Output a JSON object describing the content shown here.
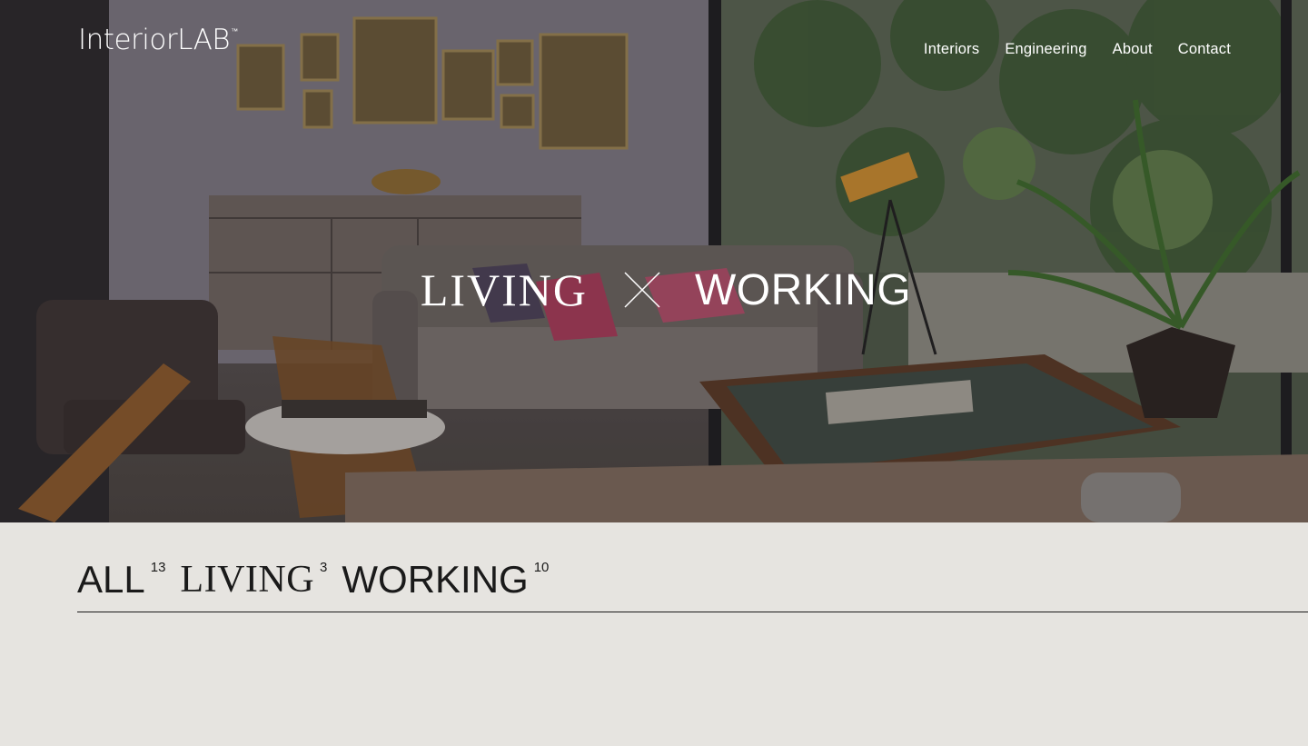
{
  "header": {
    "logo_text": "InteriorLAB",
    "logo_tm": "™",
    "nav": [
      "Interiors",
      "Engineering",
      "About",
      "Contact"
    ]
  },
  "hero": {
    "title_left": "LIVING",
    "title_right": "WORKING",
    "separator_icon": "x-cross-icon"
  },
  "filters": {
    "all_label": "ALL",
    "all_count": "13",
    "living_label": "LIVING",
    "living_count": "3",
    "working_label": "WORKING",
    "working_count": "10"
  },
  "colors": {
    "page_bg": "#e6e4e0",
    "text_dark": "#1a1a1a",
    "hero_text": "#ffffff"
  }
}
